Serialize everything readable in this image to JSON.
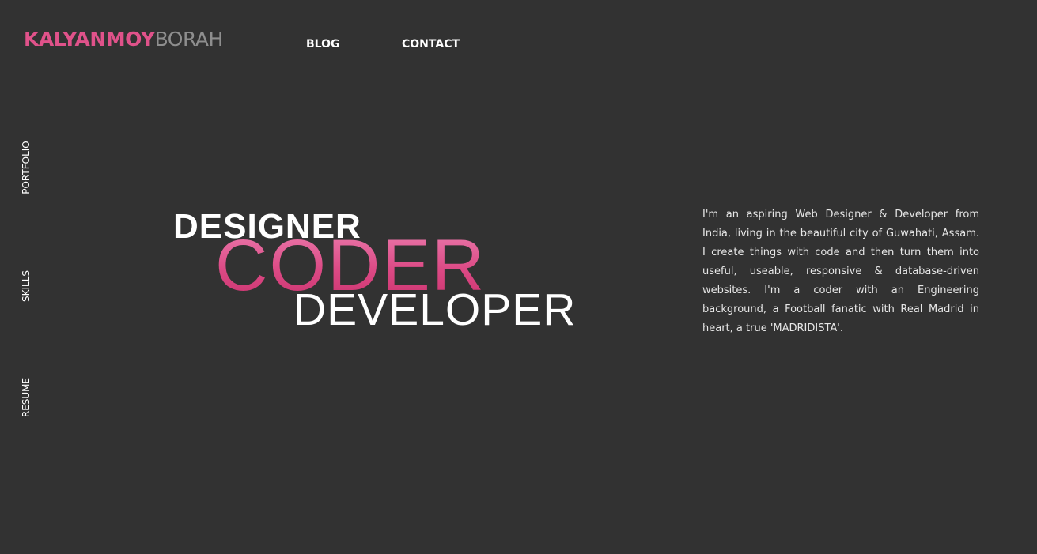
{
  "header": {
    "logo_first": "KALYANMOY",
    "logo_last": "BORAH",
    "nav": {
      "blog": "BLOG",
      "contact": "CONTACT"
    }
  },
  "side_nav": {
    "portfolio": "PORTFOLIO",
    "skills": "SKILLS",
    "resume": "RESUME"
  },
  "hero": {
    "word_1": "DESIGNER",
    "word_2": "CODER",
    "word_3": "DEVELOPER"
  },
  "bio": {
    "text": "I'm an aspiring Web Designer & Developer from India, living in the beautiful city of Guwahati, Assam. I create things with code and then turn them into useful, useable, responsive & database-driven websites. I'm a coder with an Engineering background, a Football fanatic with Real Madrid in heart, a true 'MADRIDISTA'."
  },
  "colors": {
    "background": "#323232",
    "accent": "#e0528a",
    "logo_secondary": "#8e8e8e",
    "text": "#ffffff"
  }
}
